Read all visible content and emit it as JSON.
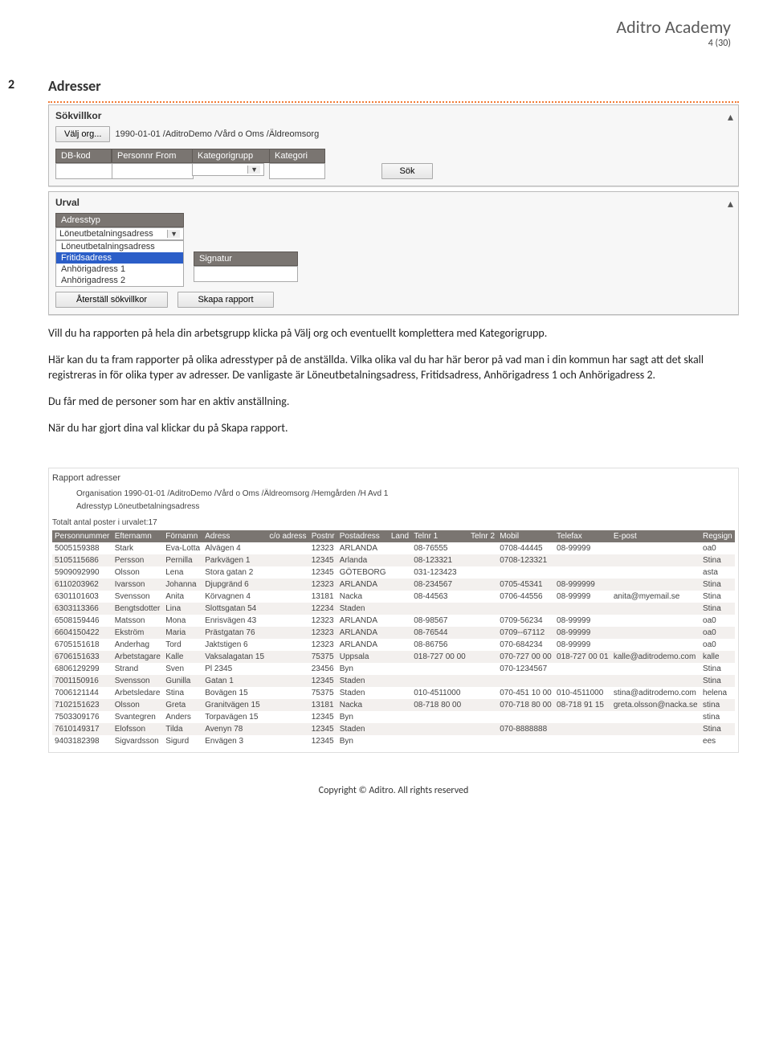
{
  "header": {
    "title": "Aditro Academy",
    "pages": "4 (30)"
  },
  "section": {
    "number": "2",
    "title": "Adresser"
  },
  "panel1": {
    "title": "Sökvillkor",
    "choose_org_btn": "Välj org...",
    "org_path": "1990-01-01 /AditroDemo /Vård o Oms /Äldreomsorg",
    "labels": {
      "dbkod": "DB-kod",
      "personnr": "Personnr From",
      "kategorigrupp": "Kategorigrupp",
      "kategori": "Kategori"
    },
    "search_btn": "Sök"
  },
  "panel2": {
    "title": "Urval",
    "adresstyp_label": "Adresstyp",
    "dropdown_current": "Löneutbetalningsadress",
    "dropdown_options": [
      "Löneutbetalningsadress",
      "Fritidsadress",
      "Anhörigadress 1",
      "Anhörigadress 2"
    ],
    "signatur_label": "Signatur",
    "reset_btn": "Återställ sökvillkor",
    "create_report_btn": "Skapa rapport"
  },
  "body": {
    "p1": "Vill du ha rapporten på hela din arbetsgrupp klicka på Välj org och eventuellt komplettera med Kategorigrupp.",
    "p2": "Här kan du ta fram rapporter på olika adresstyper på de anställda. Vilka olika val du har här beror på vad man i din kommun har sagt att det skall registreras in för olika typer av adresser. De vanligaste är Löneutbetalningsadress, Fritidsadress, Anhörigadress 1 och Anhörigadress 2.",
    "p3": "Du får med de personer som har en aktiv anställning.",
    "p4": "När du har gjort dina val klickar du på Skapa rapport."
  },
  "report": {
    "title": "Rapport adresser",
    "org": "Organisation 1990-01-01 /AditroDemo /Vård o Oms /Äldreomsorg /Hemgården /H Avd 1",
    "adresstyp": "Adresstyp Löneutbetalningsadress",
    "total": "Totalt antal poster i urvalet:17",
    "headers": [
      "Personnummer",
      "Efternamn",
      "Förnamn",
      "Adress",
      "c/o adress",
      "Postnr",
      "Postadress",
      "Land",
      "Telnr 1",
      "Telnr 2",
      "Mobil",
      "Telefax",
      "E-post",
      "Regsign"
    ],
    "rows": [
      [
        "5005159388",
        "Stark",
        "Eva-Lotta",
        "Alvägen 4",
        "",
        "12323",
        "ARLANDA",
        "",
        "08-76555",
        "",
        "0708-44445",
        "08-99999",
        "",
        "oa0"
      ],
      [
        "5105115686",
        "Persson",
        "Pernilla",
        "Parkvägen 1",
        "",
        "12345",
        "Arlanda",
        "",
        "08-123321",
        "",
        "0708-123321",
        "",
        "",
        "Stina"
      ],
      [
        "5909092990",
        "Olsson",
        "Lena",
        "Stora gatan 2",
        "",
        "12345",
        "GÖTEBORG",
        "",
        "031-123423",
        "",
        "",
        "",
        "",
        "asta"
      ],
      [
        "6110203962",
        "Ivarsson",
        "Johanna",
        "Djupgränd 6",
        "",
        "12323",
        "ARLANDA",
        "",
        "08-234567",
        "",
        "0705-45341",
        "08-999999",
        "",
        "Stina"
      ],
      [
        "6301101603",
        "Svensson",
        "Anita",
        "Körvagnen 4",
        "",
        "13181",
        "Nacka",
        "",
        "08-44563",
        "",
        "0706-44556",
        "08-99999",
        "anita@myemail.se",
        "Stina"
      ],
      [
        "6303113366",
        "Bengtsdotter",
        "Lina",
        "Slottsgatan 54",
        "",
        "12234",
        "Staden",
        "",
        "",
        "",
        "",
        "",
        "",
        "Stina"
      ],
      [
        "6508159446",
        "Matsson",
        "Mona",
        "Enrisvägen 43",
        "",
        "12323",
        "ARLANDA",
        "",
        "08-98567",
        "",
        "0709-56234",
        "08-99999",
        "",
        "oa0"
      ],
      [
        "6604150422",
        "Ekström",
        "Maria",
        "Prästgatan 76",
        "",
        "12323",
        "ARLANDA",
        "",
        "08-76544",
        "",
        "0709--67112",
        "08-99999",
        "",
        "oa0"
      ],
      [
        "6705151618",
        "Anderhag",
        "Tord",
        "Jaktstigen 6",
        "",
        "12323",
        "ARLANDA",
        "",
        "08-86756",
        "",
        "070-684234",
        "08-99999",
        "",
        "oa0"
      ],
      [
        "6706151633",
        "Arbetstagare",
        "Kalle",
        "Vaksalagatan 15",
        "",
        "75375",
        "Uppsala",
        "",
        "018-727 00 00",
        "",
        "070-727 00 00",
        "018-727 00 01",
        "kalle@aditrodemo.com",
        "kalle"
      ],
      [
        "6806129299",
        "Strand",
        "Sven",
        "Pl 2345",
        "",
        "23456",
        "Byn",
        "",
        "",
        "",
        "070-1234567",
        "",
        "",
        "Stina"
      ],
      [
        "7001150916",
        "Svensson",
        "Gunilla",
        "Gatan 1",
        "",
        "12345",
        "Staden",
        "",
        "",
        "",
        "",
        "",
        "",
        "Stina"
      ],
      [
        "7006121144",
        "Arbetsledare",
        "Stina",
        "Bovägen 15",
        "",
        "75375",
        "Staden",
        "",
        "010-4511000",
        "",
        "070-451 10 00",
        "010-4511000",
        "stina@aditrodemo.com",
        "helena"
      ],
      [
        "7102151623",
        "Olsson",
        "Greta",
        "Granitvägen 15",
        "",
        "13181",
        "Nacka",
        "",
        "08-718 80 00",
        "",
        "070-718 80 00",
        "08-718 91 15",
        "greta.olsson@nacka.se",
        "stina"
      ],
      [
        "7503309176",
        "Svantegren",
        "Anders",
        "Torpavägen 15",
        "",
        "12345",
        "Byn",
        "",
        "",
        "",
        "",
        "",
        "",
        "stina"
      ],
      [
        "7610149317",
        "Elofsson",
        "Tilda",
        "Avenyn 78",
        "",
        "12345",
        "Staden",
        "",
        "",
        "",
        "070-8888888",
        "",
        "",
        "Stina"
      ],
      [
        "9403182398",
        "Sigvardsson",
        "Sigurd",
        "Envägen 3",
        "",
        "12345",
        "Byn",
        "",
        "",
        "",
        "",
        "",
        "",
        "ees"
      ]
    ]
  },
  "footer": "Copyright © Aditro. All rights reserved"
}
